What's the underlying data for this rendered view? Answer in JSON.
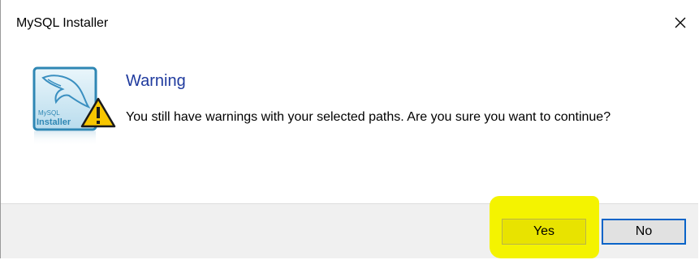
{
  "window": {
    "title": "MySQL Installer",
    "close_icon": "close-icon"
  },
  "icon": {
    "name": "mysql-installer-warning-icon",
    "mysql_text": "MySQL",
    "installer_text": "Installer"
  },
  "dialog": {
    "heading": "Warning",
    "message": "You still have warnings with your selected paths.  Are you sure you want to continue?"
  },
  "buttons": {
    "yes_label": "Yes",
    "no_label": "No"
  },
  "colors": {
    "heading": "#1f3a9e",
    "highlight": "#f4f300",
    "focus_border": "#0a64c8"
  }
}
